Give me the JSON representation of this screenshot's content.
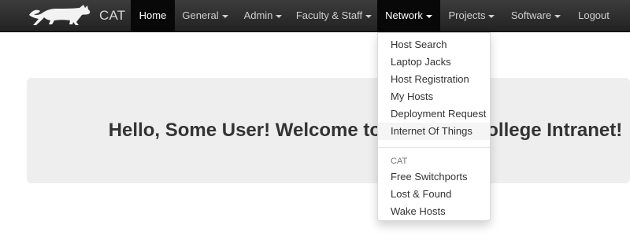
{
  "brand": {
    "name": "CAT",
    "logo_icon": "cat-silhouette-icon"
  },
  "nav": {
    "home": "Home",
    "general": "General",
    "admin": "Admin",
    "faculty_staff": "Faculty & Staff",
    "network": "Network",
    "projects": "Projects",
    "software": "Software",
    "logout": "Logout"
  },
  "network_menu": {
    "items": [
      "Host Search",
      "Laptop Jacks",
      "Host Registration",
      "My Hosts",
      "Deployment Request",
      "Internet Of Things"
    ],
    "header": "CAT",
    "cat_items": [
      "Free Switchports",
      "Lost & Found",
      "Wake Hosts"
    ],
    "highlighted": "Internet Of Things"
  },
  "greeting": "Hello, Some User! Welcome to the CAT / College Intranet!",
  "colors": {
    "navbar": "#222222",
    "active": "#080808",
    "jumbotron": "#eeeeee",
    "text": "#333333"
  }
}
